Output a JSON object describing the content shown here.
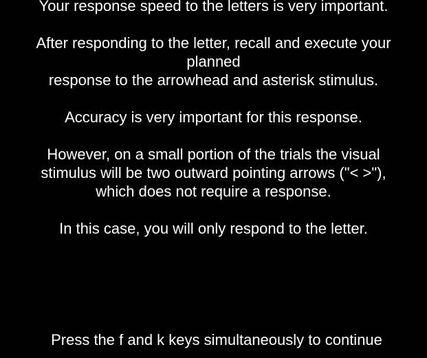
{
  "colors": {
    "background": "#000000",
    "text": "#ffffff"
  },
  "instructions": {
    "paragraphs": [
      "Your response speed to the letters is very important.",
      "After responding to the letter, recall and execute your\nplanned\n response to the arrowhead and asterisk stimulus.",
      "Accuracy is very important for this response.",
      "However, on a small portion of the trials the visual\nstimulus will be two outward pointing arrows (\"< >\"),\nwhich does not require a response.",
      "In this case, you will only respond to the letter."
    ]
  },
  "footer": {
    "continue_prompt": "Press the f and k keys simultaneously to continue"
  }
}
